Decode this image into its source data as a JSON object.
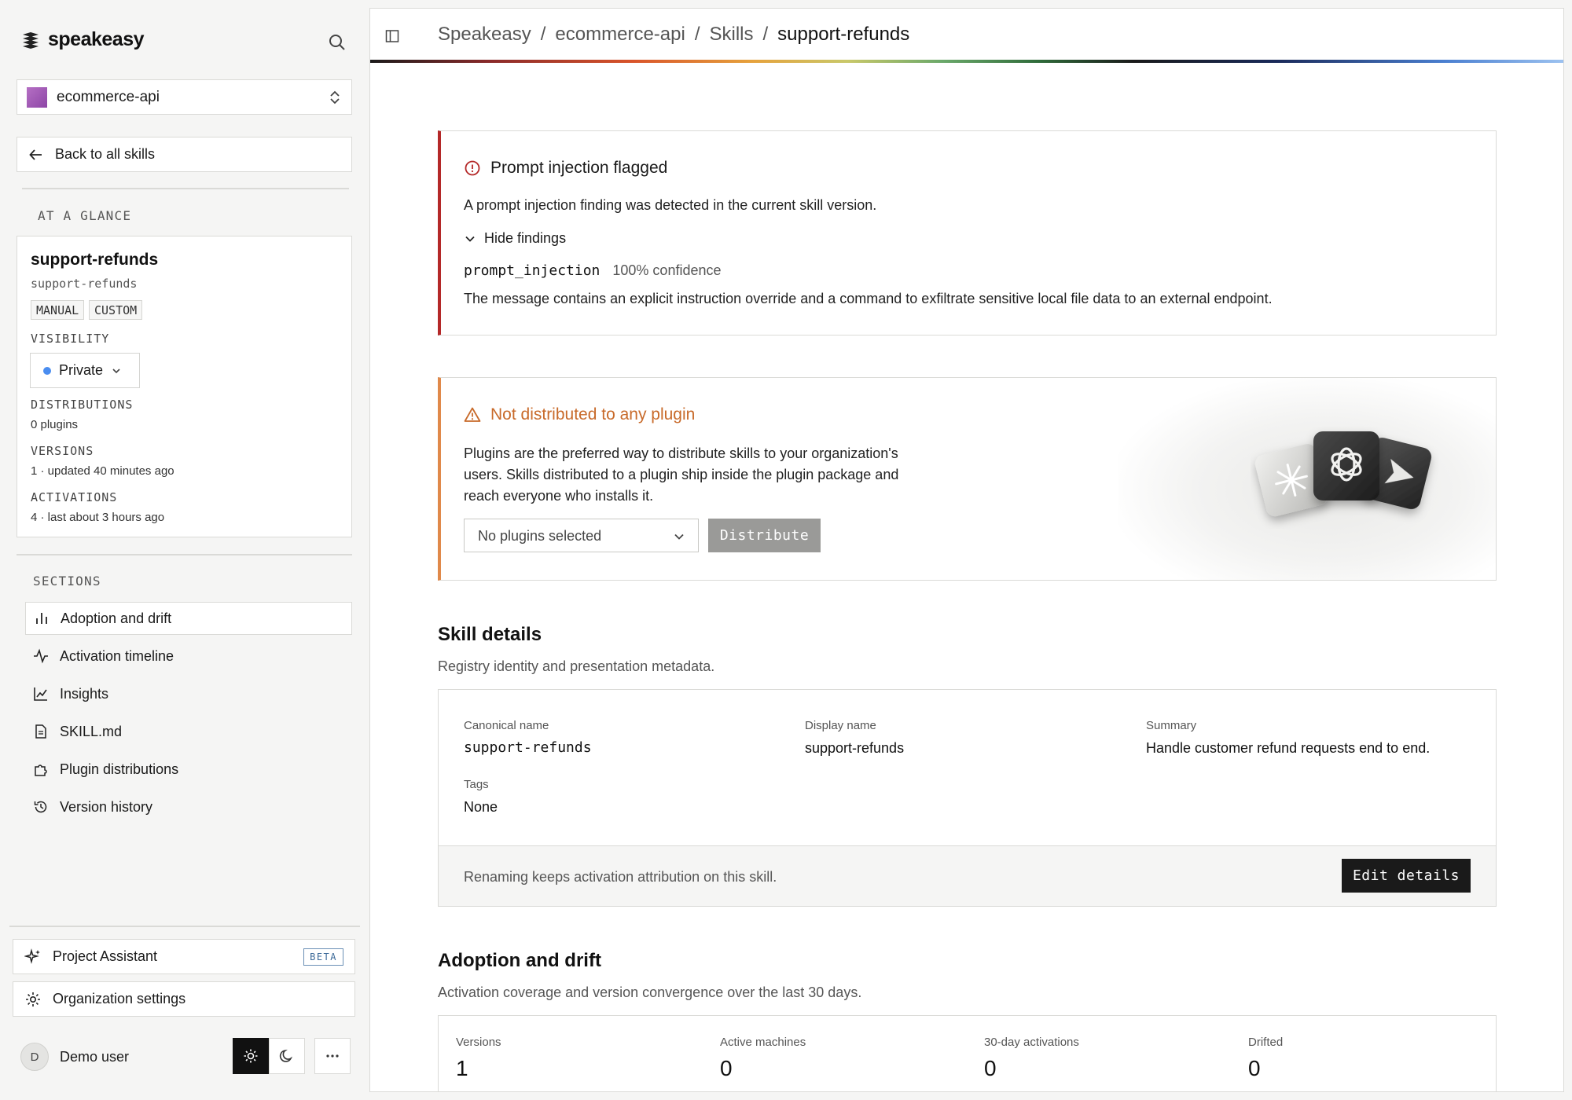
{
  "brand": {
    "name": "speakeasy"
  },
  "project": {
    "name": "ecommerce-api"
  },
  "back_label": "Back to all skills",
  "glance": {
    "section_label": "AT A GLANCE",
    "title": "support-refunds",
    "slug": "support-refunds",
    "chips": [
      "MANUAL",
      "CUSTOM"
    ],
    "visibility_label": "VISIBILITY",
    "visibility_value": "Private",
    "distributions_label": "DISTRIBUTIONS",
    "distributions_value": "0 plugins",
    "versions_label": "VERSIONS",
    "versions_value": "1 · updated 40 minutes ago",
    "activations_label": "ACTIVATIONS",
    "activations_value": "4 · last about 3 hours ago"
  },
  "sections": {
    "label": "SECTIONS",
    "items": [
      {
        "label": "Adoption and drift",
        "icon": "bar-chart-icon"
      },
      {
        "label": "Activation timeline",
        "icon": "activity-icon"
      },
      {
        "label": "Insights",
        "icon": "line-chart-icon"
      },
      {
        "label": "SKILL.md",
        "icon": "file-icon"
      },
      {
        "label": "Plugin distributions",
        "icon": "puzzle-icon"
      },
      {
        "label": "Version history",
        "icon": "history-icon"
      }
    ]
  },
  "bottom": {
    "assistant_label": "Project Assistant",
    "assistant_badge": "BETA",
    "org_settings_label": "Organization settings",
    "user_initial": "D",
    "user_name": "Demo user"
  },
  "breadcrumb": [
    "Speakeasy",
    "ecommerce-api",
    "Skills",
    "support-refunds"
  ],
  "injection_alert": {
    "title": "Prompt injection flagged",
    "description": "A prompt injection finding was detected in the current skill version.",
    "toggle_label": "Hide findings",
    "finding_code": "prompt_injection",
    "finding_confidence": "100% confidence",
    "finding_message": "The message contains an explicit instruction override and a command to exfiltrate sensitive local file data to an external endpoint."
  },
  "distribution_alert": {
    "title": "Not distributed to any plugin",
    "line1": "Plugins are the preferred way to distribute skills to your organization's",
    "line2": "users. Skills distributed to a plugin ship inside the plugin package and",
    "line3": "reach everyone who installs it.",
    "select_placeholder": "No plugins selected",
    "button_label": "Distribute"
  },
  "skill_details": {
    "title": "Skill details",
    "subtitle": "Registry identity and presentation metadata.",
    "canonical_label": "Canonical name",
    "canonical_value": "support-refunds",
    "display_label": "Display name",
    "display_value": "support-refunds",
    "summary_label": "Summary",
    "summary_value": "Handle customer refund requests end to end.",
    "tags_label": "Tags",
    "tags_value": "None",
    "footer_note": "Renaming keeps activation attribution on this skill.",
    "edit_label": "Edit details"
  },
  "adoption": {
    "title": "Adoption and drift",
    "subtitle": "Activation coverage and version convergence over the last 30 days.",
    "stats": [
      {
        "label": "Versions",
        "value": "1"
      },
      {
        "label": "Active machines",
        "value": "0"
      },
      {
        "label": "30-day activations",
        "value": "0"
      },
      {
        "label": "Drifted",
        "value": "0"
      }
    ]
  },
  "colors": {
    "danger": "#b42828",
    "warning": "#c86a2a",
    "accent_blue": "#4a8df0"
  }
}
